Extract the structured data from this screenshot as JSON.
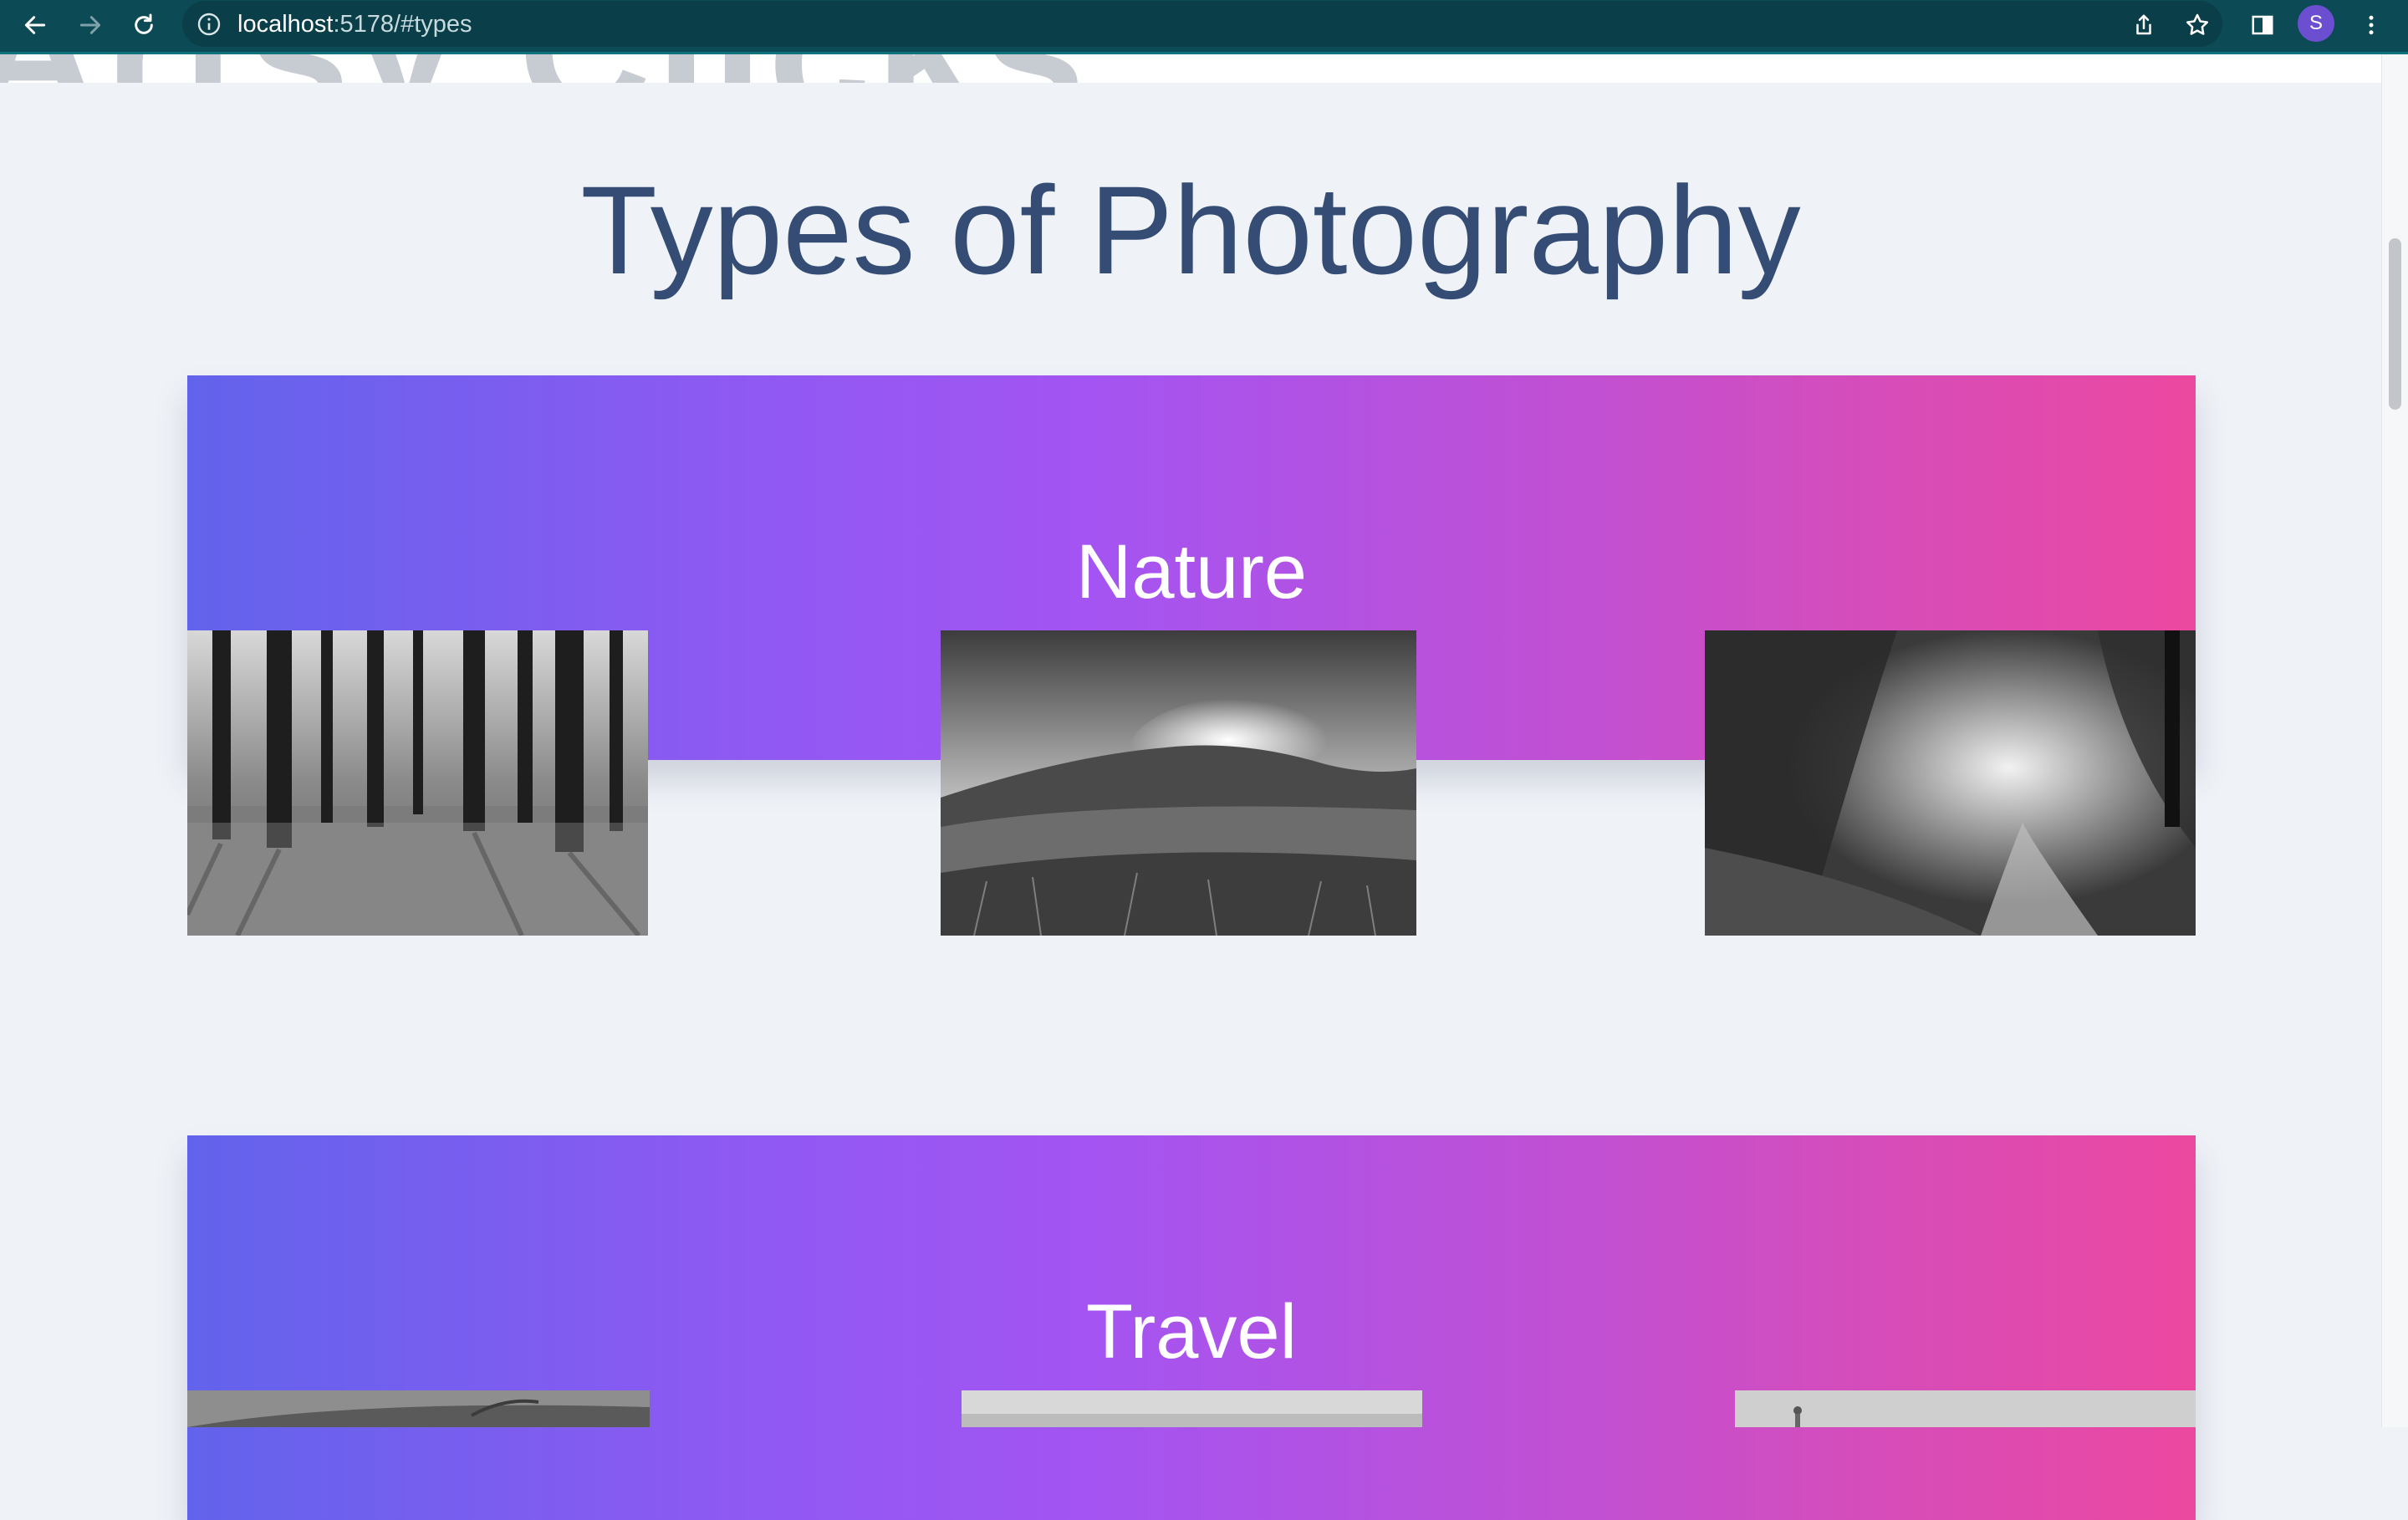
{
  "browser": {
    "url_host": "localhost",
    "url_rest": ":5178/#types",
    "profile_initial": "S",
    "icons": [
      "back-arrow-icon",
      "forward-arrow-icon",
      "reload-icon",
      "info-icon",
      "share-icon",
      "star-icon",
      "side-panel-icon",
      "menu-dots-icon"
    ]
  },
  "page": {
    "brand_ghost": "Artsy Clicks",
    "title": "Types of Photography"
  },
  "sections": [
    {
      "title": "Nature",
      "photos": [
        "forest-trees-photo",
        "mountain-sunset-photo",
        "woodland-path-photo"
      ]
    },
    {
      "title": "Travel",
      "photos": [
        "travel-photo-1",
        "travel-photo-2",
        "travel-photo-3"
      ]
    }
  ],
  "colors": {
    "chrome_bar": "#0c4a56",
    "page_background": "#eff3f8",
    "title_text": "#354d75",
    "gradient_start": "#6263ec",
    "gradient_mid": "#a454f2",
    "gradient_end": "#ec489f"
  }
}
